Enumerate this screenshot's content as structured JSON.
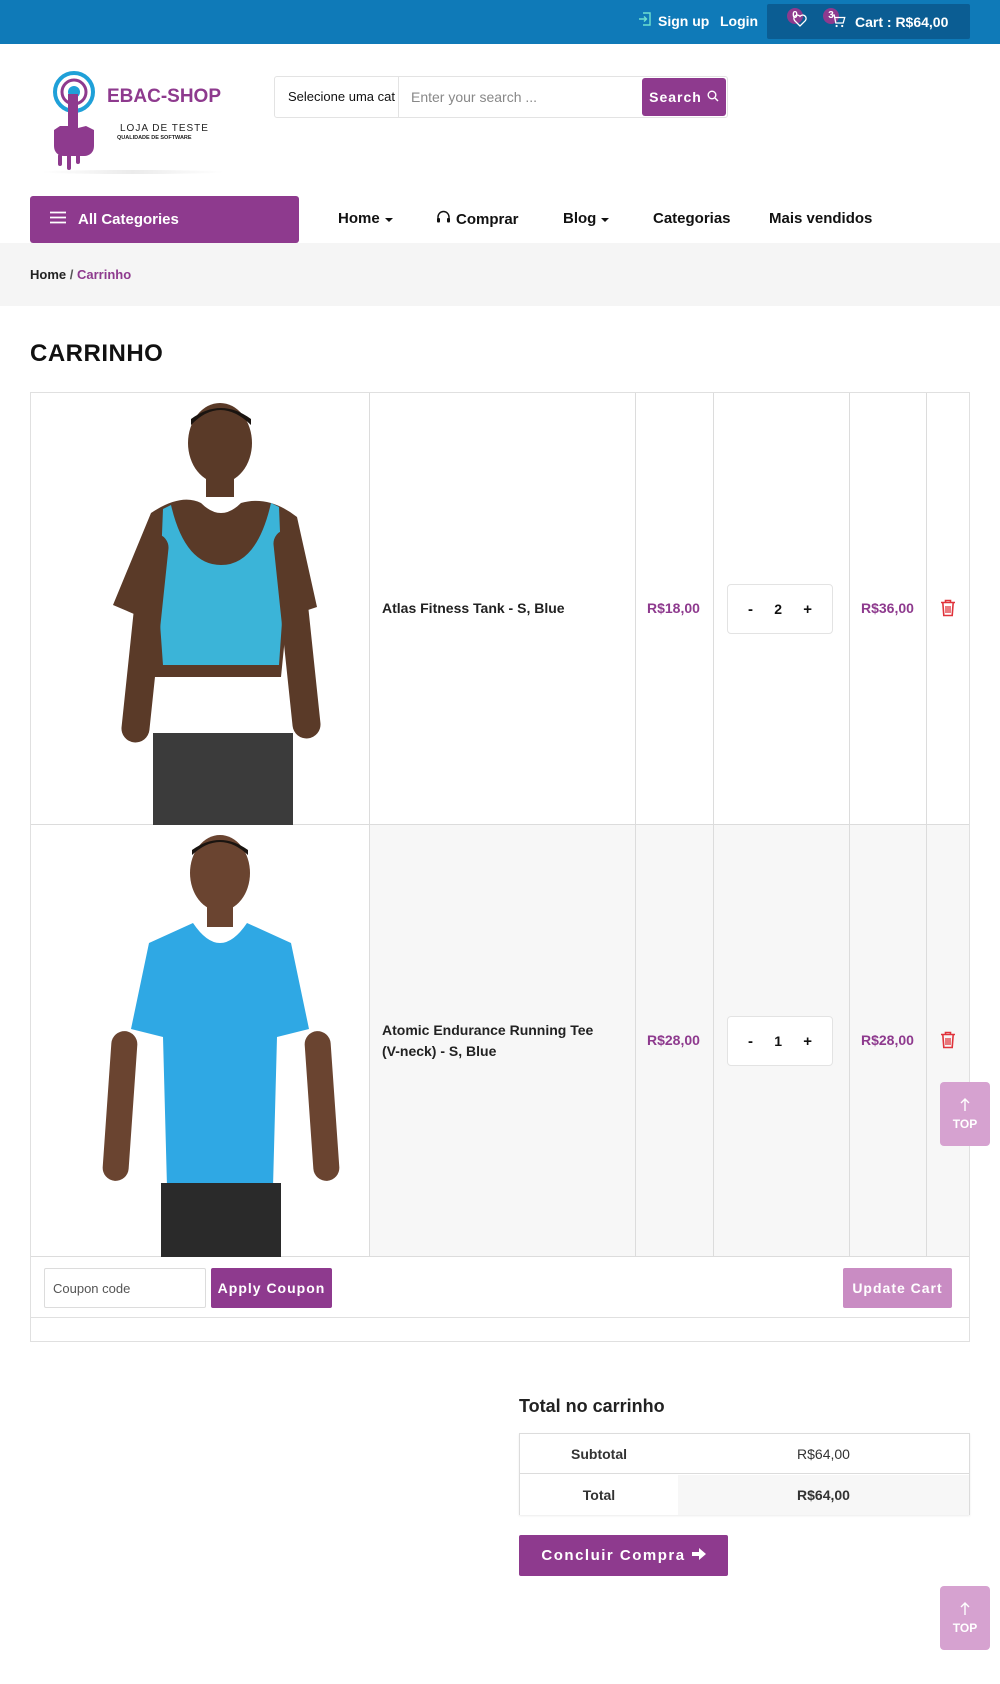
{
  "topbar": {
    "signup_label": "Sign up",
    "login_label": "Login",
    "wishlist_count": "0",
    "cart_count": "3",
    "cart_label": "Cart : R$64,00"
  },
  "logo": {
    "brand": "EBAC-SHOP",
    "subtitle": "LOJA DE TESTE",
    "tagline": "QUALIDADE DE SOFTWARE"
  },
  "search": {
    "category": "Selecione uma cat",
    "placeholder": "Enter your search ...",
    "button_label": "Search"
  },
  "nav": {
    "all_categories": "All Categories",
    "home": "Home",
    "comprar": "Comprar",
    "blog": "Blog",
    "categorias": "Categorias",
    "mais_vendidos": "Mais vendidos"
  },
  "breadcrumb": {
    "home": "Home",
    "separator": "/",
    "current": "Carrinho"
  },
  "page_title": "CARRINHO",
  "cart": {
    "items": [
      {
        "name": "Atlas Fitness Tank - S, Blue",
        "price": "R$18,00",
        "qty": "2",
        "subtotal": "R$36,00",
        "shirt_color": "#3bb4d8"
      },
      {
        "name": "Atomic Endurance Running Tee (V-neck) - S, Blue",
        "price": "R$28,00",
        "qty": "1",
        "subtotal": "R$28,00",
        "shirt_color": "#2fa8e4"
      }
    ],
    "coupon_placeholder": "Coupon code",
    "apply_label": "Apply Coupon",
    "update_label": "Update Cart"
  },
  "totals": {
    "title": "Total no carrinho",
    "subtotal_label": "Subtotal",
    "subtotal_value": "R$64,00",
    "total_label": "Total",
    "total_value": "R$64,00",
    "checkout_label": "Concluir Compra"
  },
  "top_label": "TOP",
  "colors": {
    "topbar": "#0f7ab8",
    "accent": "#8e3a8e",
    "accent_light": "#c98cc3",
    "top_button": "#d6a2d0",
    "delete": "#e0333b"
  }
}
